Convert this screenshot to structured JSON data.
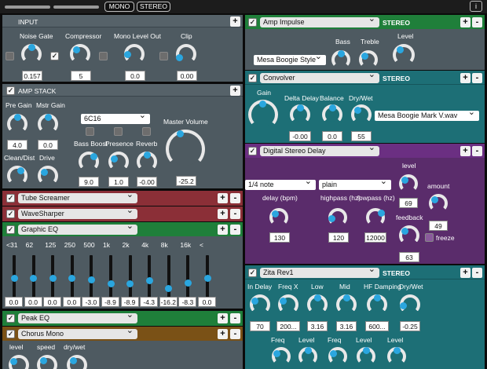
{
  "topbar": {
    "mono": "MONO",
    "stereo": "STEREO",
    "info": "i"
  },
  "colors": {
    "gray": "#4e5a61",
    "red": "#8b2f37",
    "green": "#1f7f3a",
    "teal": "#1d6f76",
    "purple": "#5a2c6b",
    "orange": "#7a5116",
    "accent": "#2aa6df"
  },
  "input": {
    "title": "INPUT",
    "labels": {
      "noise_gate": "Noise Gate",
      "compressor": "Compressor",
      "mono_level": "Mono Level Out",
      "clip": "Clip"
    },
    "values": {
      "noise_gate": "0.157",
      "compressor": "5",
      "mono_level": "0.0",
      "clip": "0.00"
    }
  },
  "amp_stack": {
    "title": "AMP STACK",
    "labels": {
      "pre_gain": "Pre Gain",
      "mstr_gain": "Mstr Gain",
      "clean_dist": "Clean/Dist",
      "drive": "Drive",
      "bass_boost": "Bass Boost",
      "presence": "Presence",
      "reverb": "Reverb",
      "master_volume": "Master Volume"
    },
    "tube": "6C16",
    "values": {
      "pre_gain": "4.0",
      "mstr_gain": "0.0",
      "bass_boost": "9.0",
      "presence": "1.0",
      "reverb": "-0.00",
      "master_volume": "-25.2"
    }
  },
  "tube_screamer": "Tube Screamer",
  "wave_sharper": "WaveSharper",
  "graphic_eq": {
    "title": "Graphic EQ",
    "bands": [
      "<31",
      "62",
      "125",
      "250",
      "500",
      "1k",
      "2k",
      "4k",
      "8k",
      "16k",
      "<"
    ],
    "values": [
      "0.0",
      "0.0",
      "0.0",
      "0.0",
      "-3.0",
      "-8.9",
      "-8.9",
      "-4.3",
      "-16.2",
      "-8.3",
      "0.0"
    ],
    "thumb_fractions": [
      0.5,
      0.5,
      0.5,
      0.5,
      0.55,
      0.65,
      0.65,
      0.58,
      0.78,
      0.64,
      0.5
    ]
  },
  "peak_eq": "Peak EQ",
  "chorus": {
    "title": "Chorus Mono",
    "labels": {
      "level": "level",
      "speed": "speed",
      "dry_wet": "dry/wet"
    }
  },
  "amp_impulse": {
    "title": "Amp Impulse",
    "stereo": "STEREO",
    "labels": {
      "bass": "Bass",
      "treble": "Treble",
      "level": "Level"
    },
    "model": "Mesa Boogie Style"
  },
  "convolver": {
    "title": "Convolver",
    "stereo": "STEREO",
    "labels": {
      "gain": "Gain",
      "delta_delay": "Delta Delay",
      "balance": "Balance",
      "dry_wet": "Dry/Wet"
    },
    "values": {
      "delta_delay": "-0.00",
      "balance": "0.0",
      "dry_wet": "55"
    },
    "ir": "Mesa Boogie Mark V.wav"
  },
  "stereo_delay": {
    "title": "Digital Stereo Delay",
    "note": "1/4 note",
    "mode": "plain",
    "labels": {
      "level": "level",
      "amount": "amount",
      "delay": "delay (bpm)",
      "highpass": "highpass (hz)",
      "lowpass": "lowpass (hz)",
      "feedback": "feedback",
      "freeze": "freeze"
    },
    "values": {
      "level": "69",
      "amount": "49",
      "delay": "130",
      "highpass": "120",
      "lowpass": "12000",
      "feedback": "63"
    }
  },
  "zita": {
    "title": "Zita Rev1",
    "stereo": "STEREO",
    "labels": {
      "in_delay": "In Delay",
      "freq_x": "Freq X",
      "low": "Low",
      "mid": "Mid",
      "hf_damping": "HF Damping",
      "dry_wet": "Dry/Wet",
      "freq1": "Freq",
      "level1": "Level",
      "freq2": "Freq",
      "level2": "Level",
      "level3": "Level"
    },
    "values": {
      "in_delay": "70",
      "freq_x": "200...",
      "low": "3.16",
      "mid": "3.16",
      "hf_damping": "600...",
      "dry_wet": "-0.25"
    }
  }
}
